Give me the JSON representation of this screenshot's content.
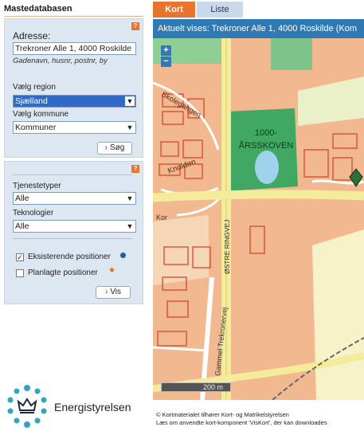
{
  "app_title": "Mastedatabasen",
  "search": {
    "address_label": "Adresse:",
    "address_value": "Trekroner Alle 1, 4000 Roskilde",
    "address_hint": "Gadenavn, husnr, postnr, by",
    "region_label": "Vælg region",
    "region_value": "Sjælland",
    "municipality_label": "Vælg kommune",
    "municipality_value": "Kommuner",
    "search_button": "Søg"
  },
  "filters": {
    "service_types_label": "Tjenestetyper",
    "service_types_value": "Alle",
    "technologies_label": "Teknologier",
    "technologies_value": "Alle",
    "existing_label": "Eksisterende positioner",
    "existing_checked": true,
    "planned_label": "Planlagte positioner",
    "planned_checked": false,
    "show_button": "Vis"
  },
  "help_icon": "?",
  "logo_text": "Energistyrelsen",
  "tabs": [
    {
      "label": "Kort",
      "active": true
    },
    {
      "label": "Liste",
      "active": false
    }
  ],
  "map": {
    "header": "Aktuelt vises: Trekroner Alle 1, 4000 Roskilde (Kom",
    "zoom_in": "+",
    "zoom_out": "−",
    "labels": {
      "skolegangen": "Skolegangen",
      "forest_line1": "1000-",
      "forest_line2": "ÅRSSKOVEN",
      "knolden": "Knolden",
      "kor": "Kor",
      "oestre_ringvej": "ØSTRE RINGVEJ",
      "gammel_trekronervej": "Gammel Trekronervej"
    },
    "scale": "200 m"
  },
  "credits": {
    "line1": "© Kortmaterialet tilhører Kort- og Matrikelstyrelsen",
    "line2": "Læs om anvendte kort-komponent 'VisKort', der kan downloades"
  },
  "colors": {
    "accent_orange": "#e8742e",
    "header_blue": "#2f79b4",
    "panel_blue": "#dde7f2",
    "select_highlight": "#3169c6",
    "map_urban": "#f2b991",
    "map_forest": "#3fa363",
    "map_road": "#f4ec9a"
  }
}
